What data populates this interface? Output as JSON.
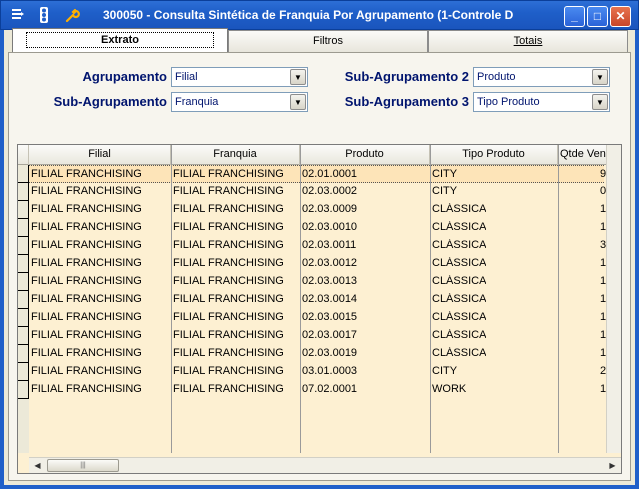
{
  "window": {
    "title": "300050 - Consulta Sintética de Franquia Por Agrupamento (1-Controle D",
    "icons": [
      "menu-icon",
      "traffic-light-icon",
      "wrench-icon"
    ],
    "buttons": [
      "minimize",
      "maximize",
      "close"
    ],
    "minimize_glyph": "_",
    "maximize_glyph": "□",
    "close_glyph": "✕"
  },
  "tabs": [
    {
      "label": "Extrato",
      "active": true
    },
    {
      "label": "Filtros",
      "active": false
    },
    {
      "label": "Totais",
      "active": false
    }
  ],
  "filters": {
    "agrupamento": {
      "label": "Agrupamento",
      "value": "Filial"
    },
    "sub_agrupamento": {
      "label": "Sub-Agrupamento",
      "value": "Franquia"
    },
    "sub_agrupamento_2": {
      "label": "Sub-Agrupamento 2",
      "value": "Produto"
    },
    "sub_agrupamento_3": {
      "label": "Sub-Agrupamento 3",
      "value": "Tipo Produto"
    }
  },
  "grid": {
    "columns": [
      "Filial",
      "Franquia",
      "Produto",
      "Tipo Produto",
      "Qtde Vend"
    ],
    "rows": [
      [
        "FILIAL FRANCHISING",
        "FILIAL FRANCHISING",
        "02.01.0001",
        "CITY",
        "9"
      ],
      [
        "FILIAL FRANCHISING",
        "FILIAL FRANCHISING",
        "02.03.0002",
        "CITY",
        "0"
      ],
      [
        "FILIAL FRANCHISING",
        "FILIAL FRANCHISING",
        "02.03.0009",
        "CLÁSSICA",
        "1"
      ],
      [
        "FILIAL FRANCHISING",
        "FILIAL FRANCHISING",
        "02.03.0010",
        "CLÁSSICA",
        "1"
      ],
      [
        "FILIAL FRANCHISING",
        "FILIAL FRANCHISING",
        "02.03.0011",
        "CLÁSSICA",
        "3"
      ],
      [
        "FILIAL FRANCHISING",
        "FILIAL FRANCHISING",
        "02.03.0012",
        "CLÁSSICA",
        "1"
      ],
      [
        "FILIAL FRANCHISING",
        "FILIAL FRANCHISING",
        "02.03.0013",
        "CLÁSSICA",
        "1"
      ],
      [
        "FILIAL FRANCHISING",
        "FILIAL FRANCHISING",
        "02.03.0014",
        "CLÁSSICA",
        "1"
      ],
      [
        "FILIAL FRANCHISING",
        "FILIAL FRANCHISING",
        "02.03.0015",
        "CLÁSSICA",
        "1"
      ],
      [
        "FILIAL FRANCHISING",
        "FILIAL FRANCHISING",
        "02.03.0017",
        "CLÁSSICA",
        "1"
      ],
      [
        "FILIAL FRANCHISING",
        "FILIAL FRANCHISING",
        "02.03.0019",
        "CLÁSSICA",
        "1"
      ],
      [
        "FILIAL FRANCHISING",
        "FILIAL FRANCHISING",
        "03.01.0003",
        "CITY",
        "2"
      ],
      [
        "FILIAL FRANCHISING",
        "FILIAL FRANCHISING",
        "07.02.0001",
        "WORK",
        "1"
      ]
    ],
    "selected_row": 0
  },
  "colors": {
    "titlebar": "#1f5fc9",
    "label_text": "#00146e",
    "grid_background": "#fdf0d2",
    "selected_row": "#fde4b8"
  }
}
